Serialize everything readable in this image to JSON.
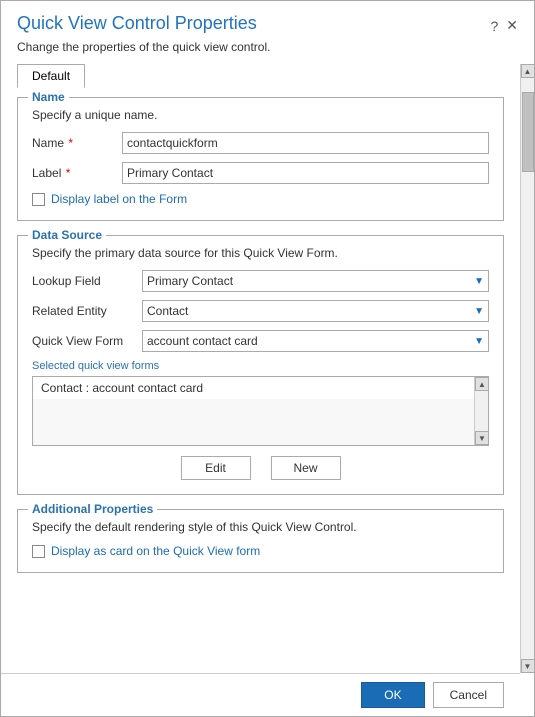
{
  "dialog": {
    "title": "Quick View Control Properties",
    "subtitle": "Change the properties of the quick view control.",
    "help_icon": "?",
    "close_icon": "✕"
  },
  "tabs": [
    {
      "label": "Default",
      "active": true
    }
  ],
  "name_section": {
    "legend": "Name",
    "description": "Specify a unique name.",
    "name_label": "Name",
    "name_required": true,
    "name_value": "contactquickform",
    "label_label": "Label",
    "label_required": true,
    "label_value": "Primary Contact",
    "checkbox_label": "Display label on the Form"
  },
  "data_source_section": {
    "legend": "Data Source",
    "description": "Specify the primary data source for this Quick View Form.",
    "lookup_field_label": "Lookup Field",
    "lookup_field_value": "Primary Contact",
    "related_entity_label": "Related Entity",
    "related_entity_value": "Contact",
    "quick_view_form_label": "Quick View Form",
    "quick_view_form_value": "account contact card",
    "selected_label": "Selected quick view forms",
    "list_item": "Contact : account contact card",
    "edit_button": "Edit",
    "new_button": "New"
  },
  "additional_section": {
    "legend": "Additional Properties",
    "description": "Specify the default rendering style of this Quick View Control.",
    "checkbox_label": "Display as card on the Quick View form"
  },
  "footer": {
    "ok_label": "OK",
    "cancel_label": "Cancel"
  }
}
